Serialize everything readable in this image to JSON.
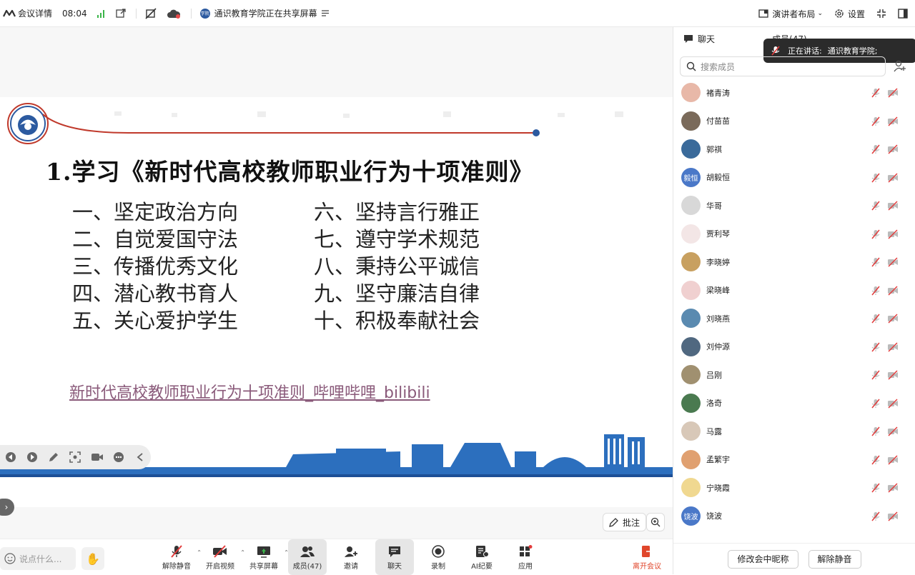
{
  "topbar": {
    "meeting_info": "会议详情",
    "time": "08:04",
    "share_badge": "学院",
    "sharing_text": "通识教育学院正在共享屏幕",
    "layout_label": "演讲者布局",
    "settings_label": "设置"
  },
  "slide": {
    "title": "1.学习《新时代高校教师职业行为十项准则》",
    "rules": [
      "一、坚定政治方向",
      "六、坚持言行雅正",
      "二、自觉爱国守法",
      "七、遵守学术规范",
      "三、传播优秀文化",
      "八、秉持公平诚信",
      "四、潜心教书育人",
      "九、坚守廉洁自律",
      "五、关心爱护学生",
      "十、积极奉献社会"
    ],
    "link_text": "新时代高校教师职业行为十项准则_哔哩哔哩_bilibili",
    "colors": {
      "accent_red": "#c0392b",
      "accent_blue": "#2c5aa0"
    }
  },
  "annotate_label": "批注",
  "bottombar": {
    "chat_placeholder": "说点什么...",
    "tools": [
      {
        "id": "mic",
        "label": "解除静音"
      },
      {
        "id": "video",
        "label": "开启视频"
      },
      {
        "id": "share",
        "label": "共享屏幕"
      },
      {
        "id": "members",
        "label": "成员(47)"
      },
      {
        "id": "invite",
        "label": "邀请"
      },
      {
        "id": "chat",
        "label": "聊天"
      },
      {
        "id": "record",
        "label": "录制"
      },
      {
        "id": "ai",
        "label": "AI纪要"
      },
      {
        "id": "apps",
        "label": "应用"
      }
    ],
    "leave_label": "离开会议"
  },
  "panel": {
    "tab_chat": "聊天",
    "tab_members": "成员(47)",
    "toast_prefix": "正在讲话:",
    "toast_name": "通识教育学院;",
    "search_placeholder": "搜索成员",
    "members": [
      {
        "name": "褚青涛",
        "avatar_text": "",
        "color": "#e8b8a8"
      },
      {
        "name": "付苗苗",
        "avatar_text": "",
        "color": "#7a6a5a"
      },
      {
        "name": "郭祺",
        "avatar_text": "",
        "color": "#3a6a9a"
      },
      {
        "name": "胡毅恒",
        "avatar_text": "毅恒",
        "color": "#4a78c8"
      },
      {
        "name": "华哥",
        "avatar_text": "",
        "color": "#d8d8d8"
      },
      {
        "name": "贾利琴",
        "avatar_text": "",
        "color": "#f3e6e6"
      },
      {
        "name": "李晓婷",
        "avatar_text": "",
        "color": "#c8a060"
      },
      {
        "name": "梁晓峰",
        "avatar_text": "",
        "color": "#f0d0d0"
      },
      {
        "name": "刘晓燕",
        "avatar_text": "",
        "color": "#5a8ab0"
      },
      {
        "name": "刘仲源",
        "avatar_text": "",
        "color": "#506880"
      },
      {
        "name": "吕刚",
        "avatar_text": "",
        "color": "#a09070"
      },
      {
        "name": "洛奇",
        "avatar_text": "",
        "color": "#4a7a50"
      },
      {
        "name": "马露",
        "avatar_text": "",
        "color": "#d8c8b8"
      },
      {
        "name": "孟繁宇",
        "avatar_text": "",
        "color": "#e0a070"
      },
      {
        "name": "宁晓霞",
        "avatar_text": "",
        "color": "#f0d890"
      },
      {
        "name": "饶波",
        "avatar_text": "饶波",
        "color": "#4a78c8"
      }
    ],
    "rename_button": "修改会中昵称",
    "unmute_button": "解除静音"
  }
}
